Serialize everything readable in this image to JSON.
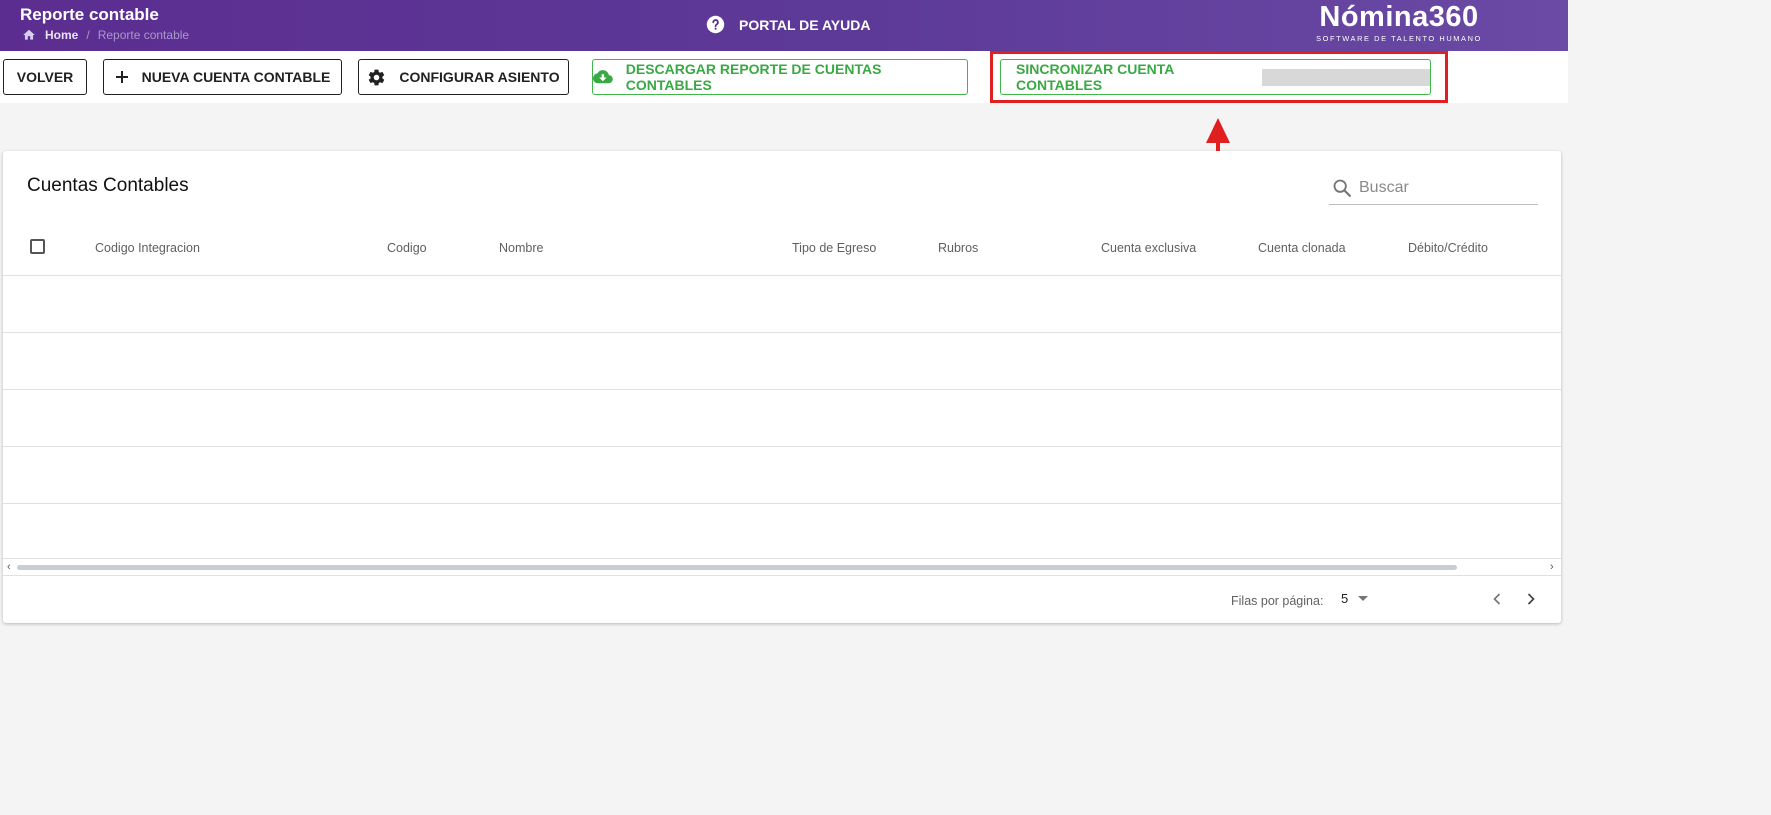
{
  "header": {
    "title": "Reporte contable",
    "breadcrumb": {
      "home": "Home",
      "separator": "/",
      "current": "Reporte contable"
    },
    "help_label": "PORTAL DE AYUDA",
    "logo": {
      "name": "Nómina360",
      "tagline": "SOFTWARE DE TALENTO HUMANO"
    }
  },
  "toolbar": {
    "back_label": "VOLVER",
    "new_account_label": "NUEVA CUENTA CONTABLE",
    "configure_label": "CONFIGURAR ASIENTO",
    "download_label": "DESCARGAR REPORTE DE CUENTAS CONTABLES",
    "sync_label": "SINCRONIZAR CUENTA CONTABLES"
  },
  "table": {
    "title": "Cuentas Contables",
    "search_placeholder": "Buscar",
    "columns": [
      "Codigo Integracion",
      "Codigo",
      "Nombre",
      "Tipo de Egreso",
      "Rubros",
      "Cuenta exclusiva",
      "Cuenta clonada",
      "Débito/Crédito"
    ],
    "rows": []
  },
  "pagination": {
    "rows_per_page_label": "Filas por página:",
    "rows_per_page_value": "5"
  },
  "colors": {
    "header_purple": "#5b2d90",
    "green_accent": "#3fb54a",
    "highlight_red": "#e02020"
  },
  "icons": [
    "home-icon",
    "help-icon",
    "plus-icon",
    "gear-icon",
    "cloud-download-icon",
    "search-icon",
    "chevron-left-icon",
    "chevron-right-icon"
  ]
}
